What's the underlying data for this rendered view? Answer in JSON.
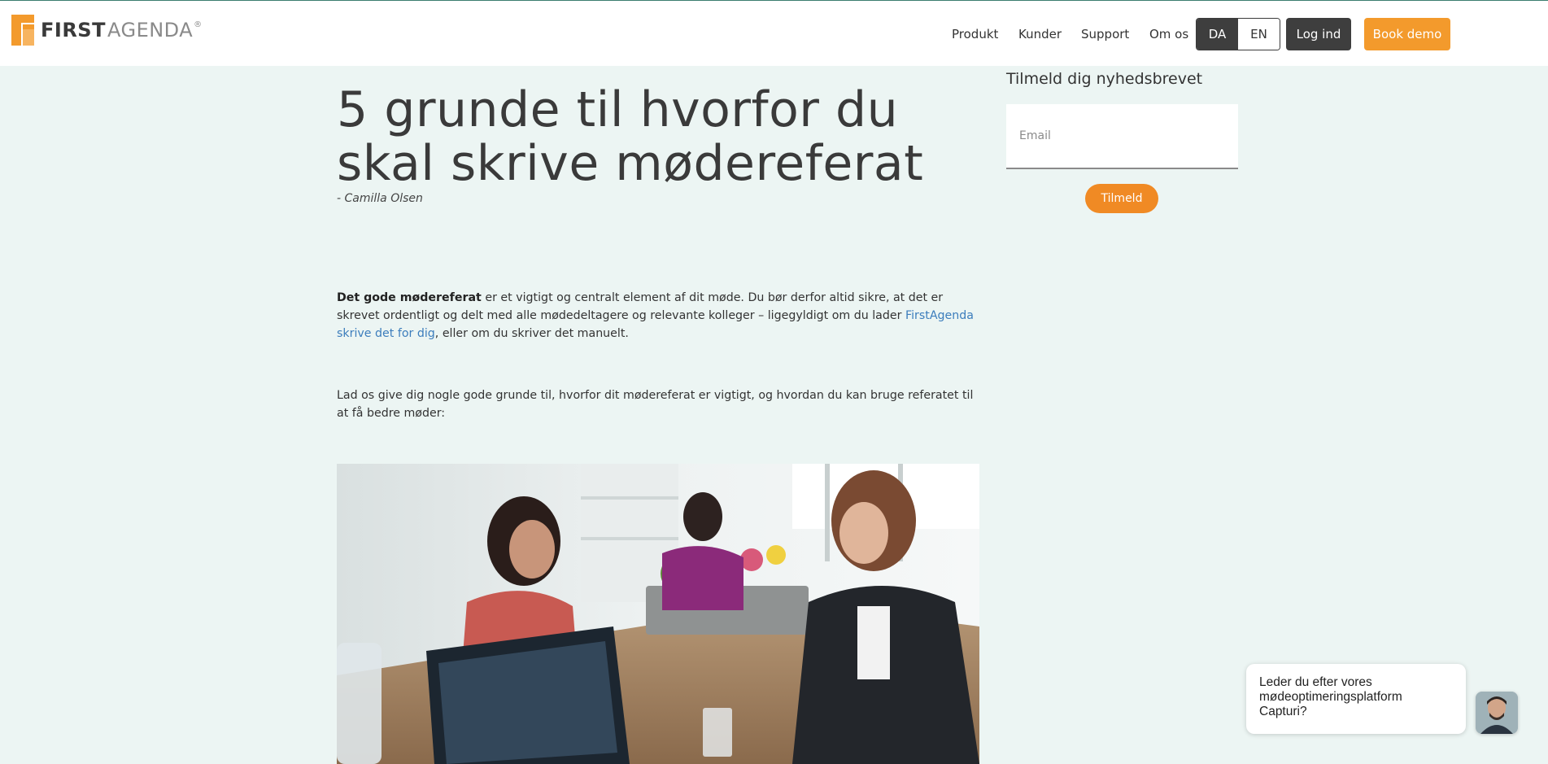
{
  "header": {
    "logo": {
      "first": "FIRST",
      "agenda": "AGENDA",
      "reg": "®"
    },
    "nav": [
      "Produkt",
      "Kunder",
      "Support",
      "Om os"
    ],
    "lang": {
      "da": "DA",
      "en": "EN",
      "active": "DA"
    },
    "login_label": "Log ind",
    "demo_label": "Book demo"
  },
  "article": {
    "title": "5 grunde til hvorfor du skal skrive mødereferat",
    "author": "- Camilla Olsen",
    "p1_bold": "Det gode mødereferat",
    "p1_text_a": " er et vigtigt og centralt element af dit møde. Du bør derfor altid sikre, at det er skrevet ordentligt og delt med alle mødedeltagere og relevante kolleger – ligegyldigt om du lader ",
    "p1_link": "FirstAgenda skrive det for dig",
    "p1_text_b": ", eller om du skriver det manuelt.",
    "p2": "Lad os give dig nogle gode grunde til, hvorfor dit mødereferat er vigtigt, og hvordan du kan bruge referatet til at få bedre møder:"
  },
  "newsletter": {
    "title": "Tilmeld dig nyhedsbrevet",
    "email_placeholder": "Email",
    "email_value": "",
    "button_label": "Tilmeld"
  },
  "chat": {
    "message": "Leder du efter vores mødeoptimeringsplatform Capturi?"
  },
  "colors": {
    "background": "#ecf5f3",
    "accent_orange": "#f39a2c",
    "dark_button": "#3e3e3e",
    "link_blue": "#3c7dbc"
  }
}
